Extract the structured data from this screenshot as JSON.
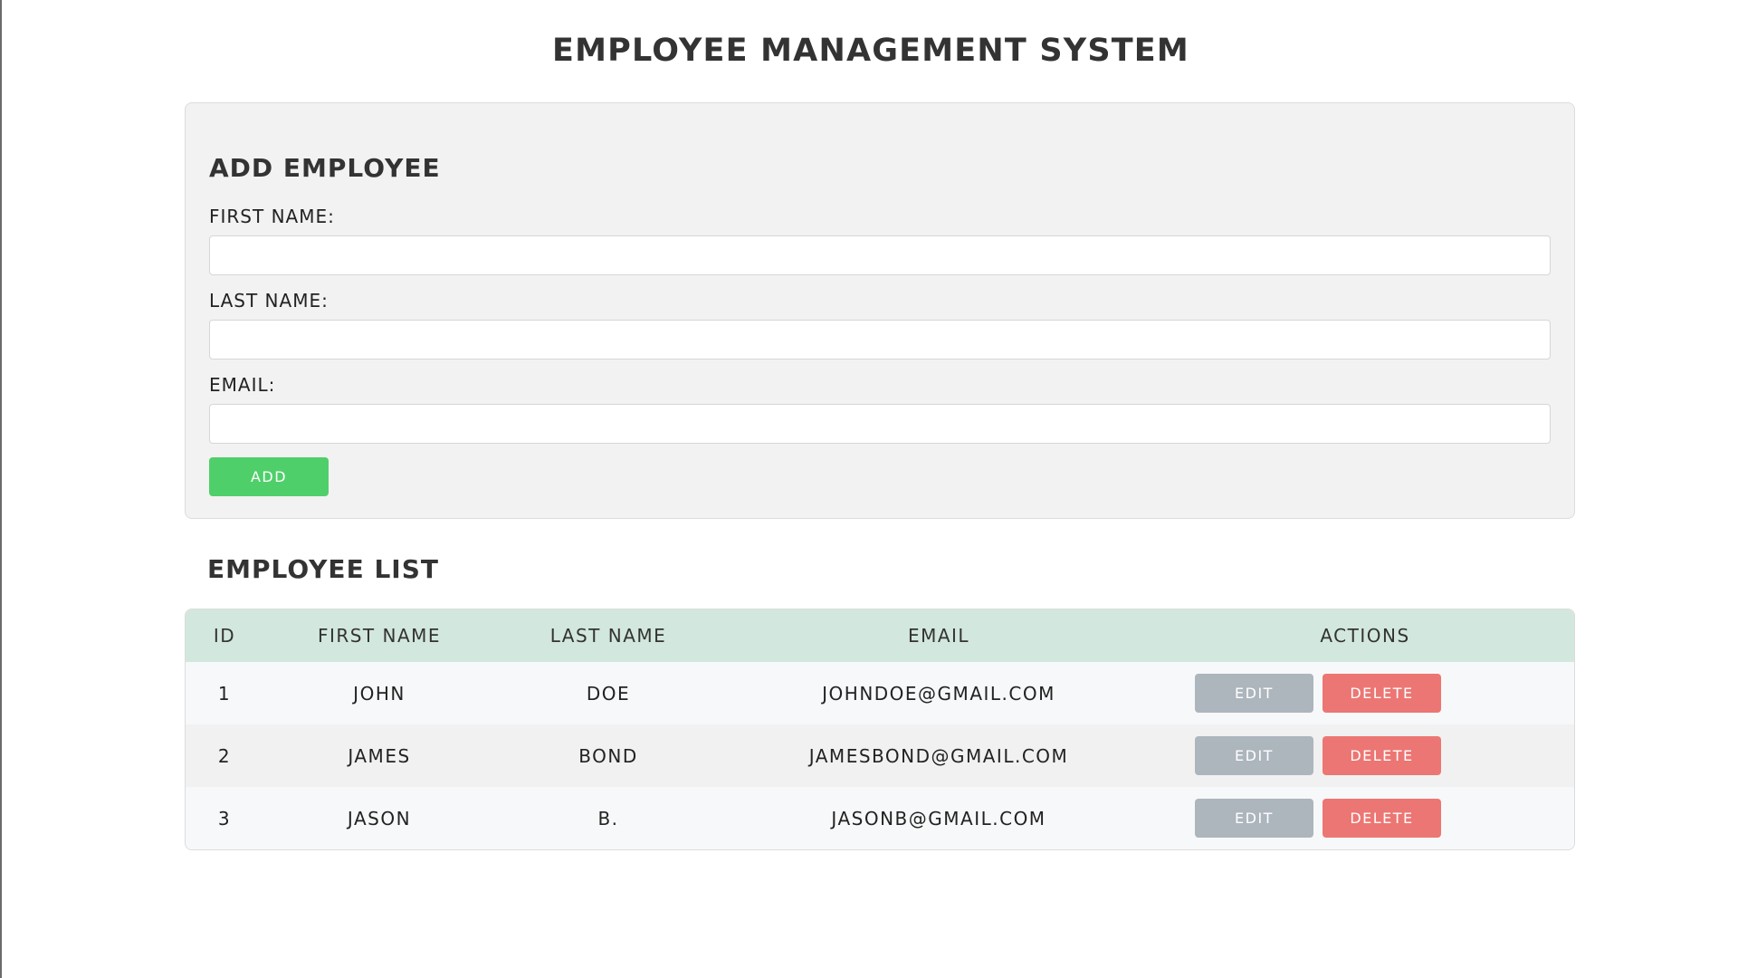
{
  "header": {
    "title": "EMPLOYEE MANAGEMENT SYSTEM"
  },
  "form": {
    "heading": "ADD EMPLOYEE",
    "first_name_label": "FIRST NAME:",
    "first_name_value": "",
    "last_name_label": "LAST NAME:",
    "last_name_value": "",
    "email_label": "EMAIL:",
    "email_value": "",
    "add_label": "ADD"
  },
  "list": {
    "heading": "EMPLOYEE LIST",
    "columns": [
      "ID",
      "FIRST NAME",
      "LAST NAME",
      "EMAIL",
      "ACTIONS"
    ],
    "rows": [
      {
        "id": "1",
        "first_name": "JOHN",
        "last_name": "DOE",
        "email": "JOHNDOE@GMAIL.COM",
        "edit_label": "EDIT",
        "delete_label": "DELETE"
      },
      {
        "id": "2",
        "first_name": "JAMES",
        "last_name": "BOND",
        "email": "JAMESBOND@GMAIL.COM",
        "edit_label": "EDIT",
        "delete_label": "DELETE"
      },
      {
        "id": "3",
        "first_name": "JASON",
        "last_name": "B.",
        "email": "JASONB@GMAIL.COM",
        "edit_label": "EDIT",
        "delete_label": "DELETE"
      }
    ]
  },
  "colors": {
    "add_button": "#4fcf6a",
    "edit_button": "#adb5bd",
    "delete_button": "#ec7673",
    "table_header": "#d2e7de",
    "form_background": "#f2f2f2"
  }
}
